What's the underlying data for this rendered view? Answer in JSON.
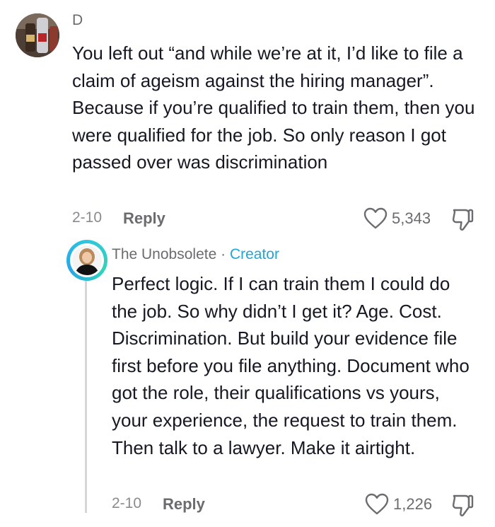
{
  "comment": {
    "author": "D",
    "text": "You left out “and while we’re at it, I’d like to file a claim of ageism against the hiring manager”. Because if you’re qualified to train them, then you were qualified for the job. So only reason I got passed over was discrimination",
    "date": "2-10",
    "reply_label": "Reply",
    "likes": "5,343"
  },
  "reply": {
    "author": "The Unobsolete",
    "separator": " · ",
    "badge": "Creator",
    "text": "Perfect logic. If I can train them I could do the job. So why didn’t I get it? Age. Cost. Discrimination. But build your evidence file first before you file anything. Document who got the role, their qualifications vs yours, your experience, the request to train them. Then talk to a lawyer. Make it airtight.",
    "date": "2-10",
    "reply_label": "Reply",
    "likes": "1,226"
  },
  "colors": {
    "creator_accent": "#1fa7d6",
    "avatar_ring": "#2ec7df",
    "muted_text": "#6b6b70",
    "body_text": "#161823"
  },
  "icons": {
    "like": "heart-outline-icon",
    "dislike": "thumbs-down-icon"
  }
}
